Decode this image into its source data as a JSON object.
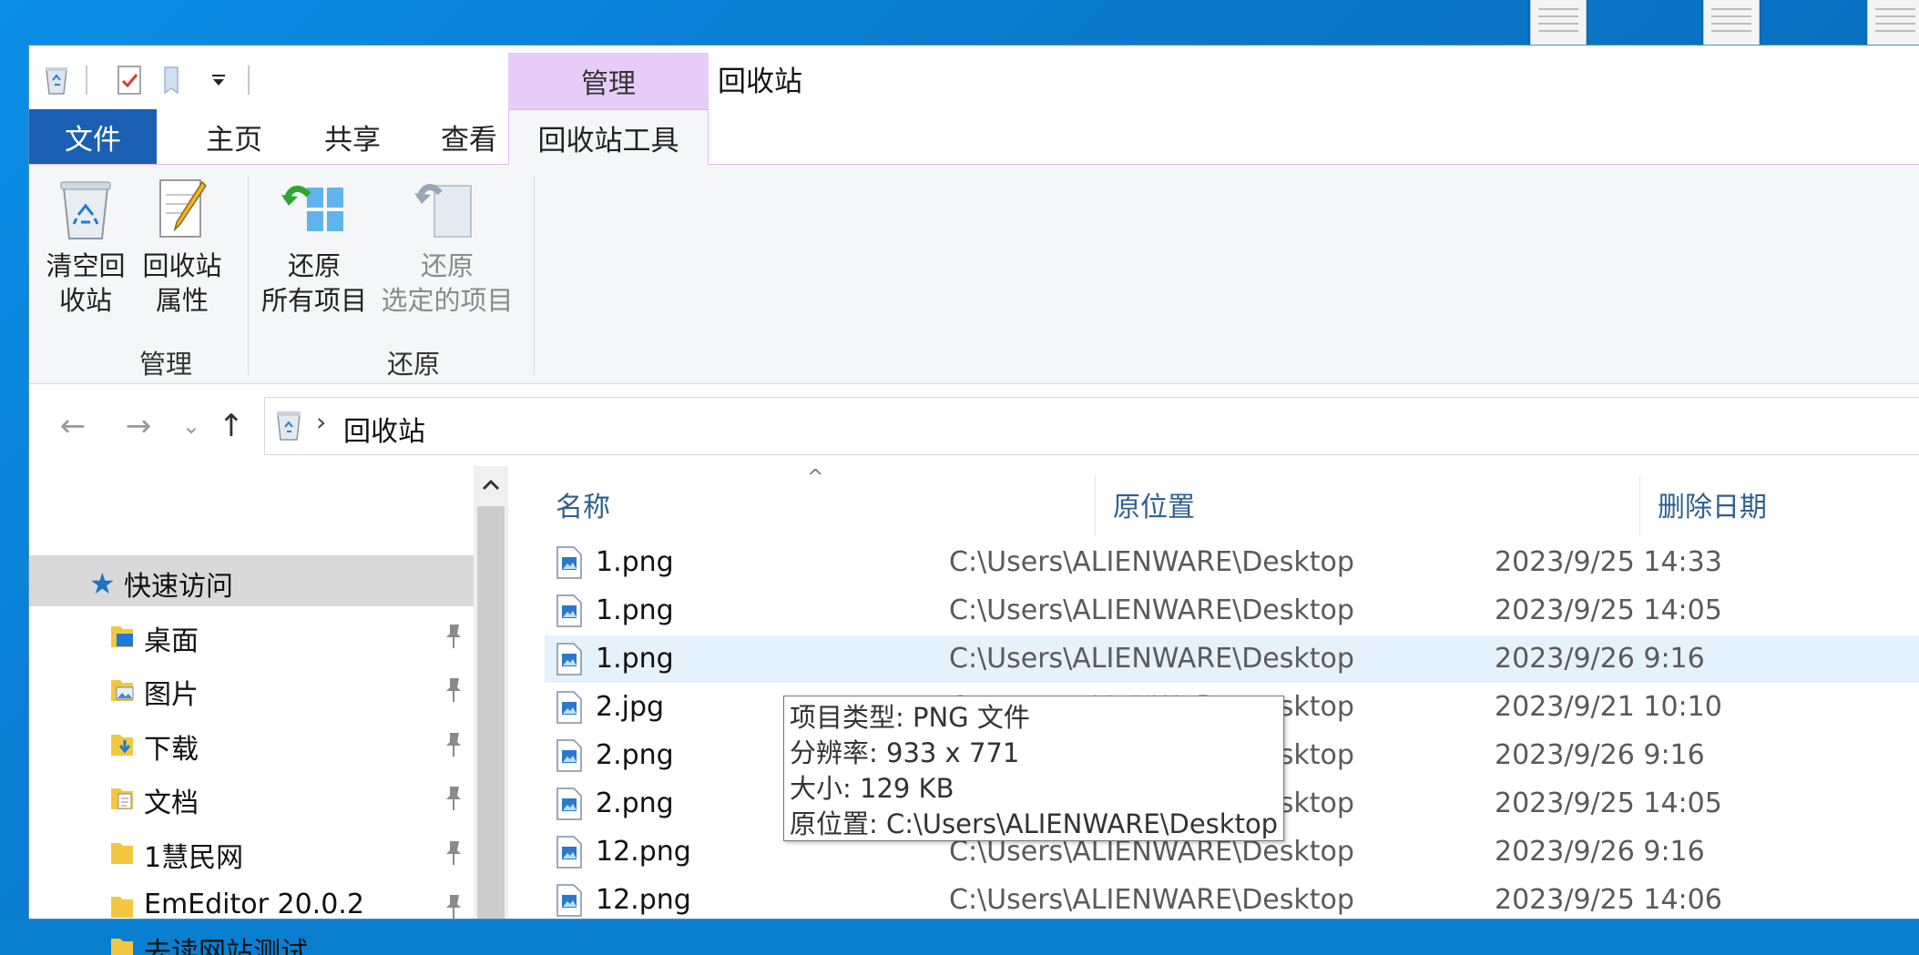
{
  "window": {
    "title": "回收站",
    "contextual_tab_group": "管理"
  },
  "ribbon_tabs": {
    "file": "文件",
    "home": "主页",
    "share": "共享",
    "view": "查看",
    "recycle_tools": "回收站工具"
  },
  "ribbon": {
    "groups": {
      "manage": "管理",
      "restore": "还原"
    },
    "buttons": {
      "empty_line1": "清空回",
      "empty_line2": "收站",
      "props_line1": "回收站",
      "props_line2": "属性",
      "restore_all_line1": "还原",
      "restore_all_line2": "所有项目",
      "restore_sel_line1": "还原",
      "restore_sel_line2": "选定的项目"
    }
  },
  "address": {
    "path": "回收站"
  },
  "nav_pane": {
    "quick_access": "快速访问",
    "items": [
      {
        "label": "桌面"
      },
      {
        "label": "图片"
      },
      {
        "label": "下载"
      },
      {
        "label": "文档"
      },
      {
        "label": "1慧民网"
      },
      {
        "label": "EmEditor 20.0.2"
      },
      {
        "label": "去读网站测试"
      }
    ]
  },
  "columns": {
    "name": "名称",
    "original_location": "原位置",
    "date_deleted": "删除日期"
  },
  "files": [
    {
      "name": "1.png",
      "location": "C:\\Users\\ALIENWARE\\Desktop",
      "date": "2023/9/25 14:33"
    },
    {
      "name": "1.png",
      "location": "C:\\Users\\ALIENWARE\\Desktop",
      "date": "2023/9/25 14:05"
    },
    {
      "name": "1.png",
      "location": "C:\\Users\\ALIENWARE\\Desktop",
      "date": "2023/9/26 9:16"
    },
    {
      "name": "2.jpg",
      "location": "C:\\Users\\ALIENWARE\\Desktop",
      "date": "2023/9/21 10:10"
    },
    {
      "name": "2.png",
      "location": "C:\\Users\\ALIENWARE\\Desktop",
      "date": "2023/9/26 9:16"
    },
    {
      "name": "2.png",
      "location": "C:\\Users\\ALIENWARE\\Desktop",
      "date": "2023/9/25 14:05"
    },
    {
      "name": "12.png",
      "location": "C:\\Users\\ALIENWARE\\Desktop",
      "date": "2023/9/26 9:16"
    },
    {
      "name": "12.png",
      "location": "C:\\Users\\ALIENWARE\\Desktop",
      "date": "2023/9/25 14:06"
    }
  ],
  "tooltip": {
    "type": "项目类型: PNG 文件",
    "resolution": "分辨率: 933 x 771",
    "size": "大小: 129 KB",
    "location": "原位置: C:\\Users\\ALIENWARE\\Desktop"
  },
  "colors": {
    "file_tab": "#1a5fb4",
    "contextual_tab": "#e6cdf7",
    "selection": "#e5f1fb",
    "desktop": "#0a7fd0"
  }
}
